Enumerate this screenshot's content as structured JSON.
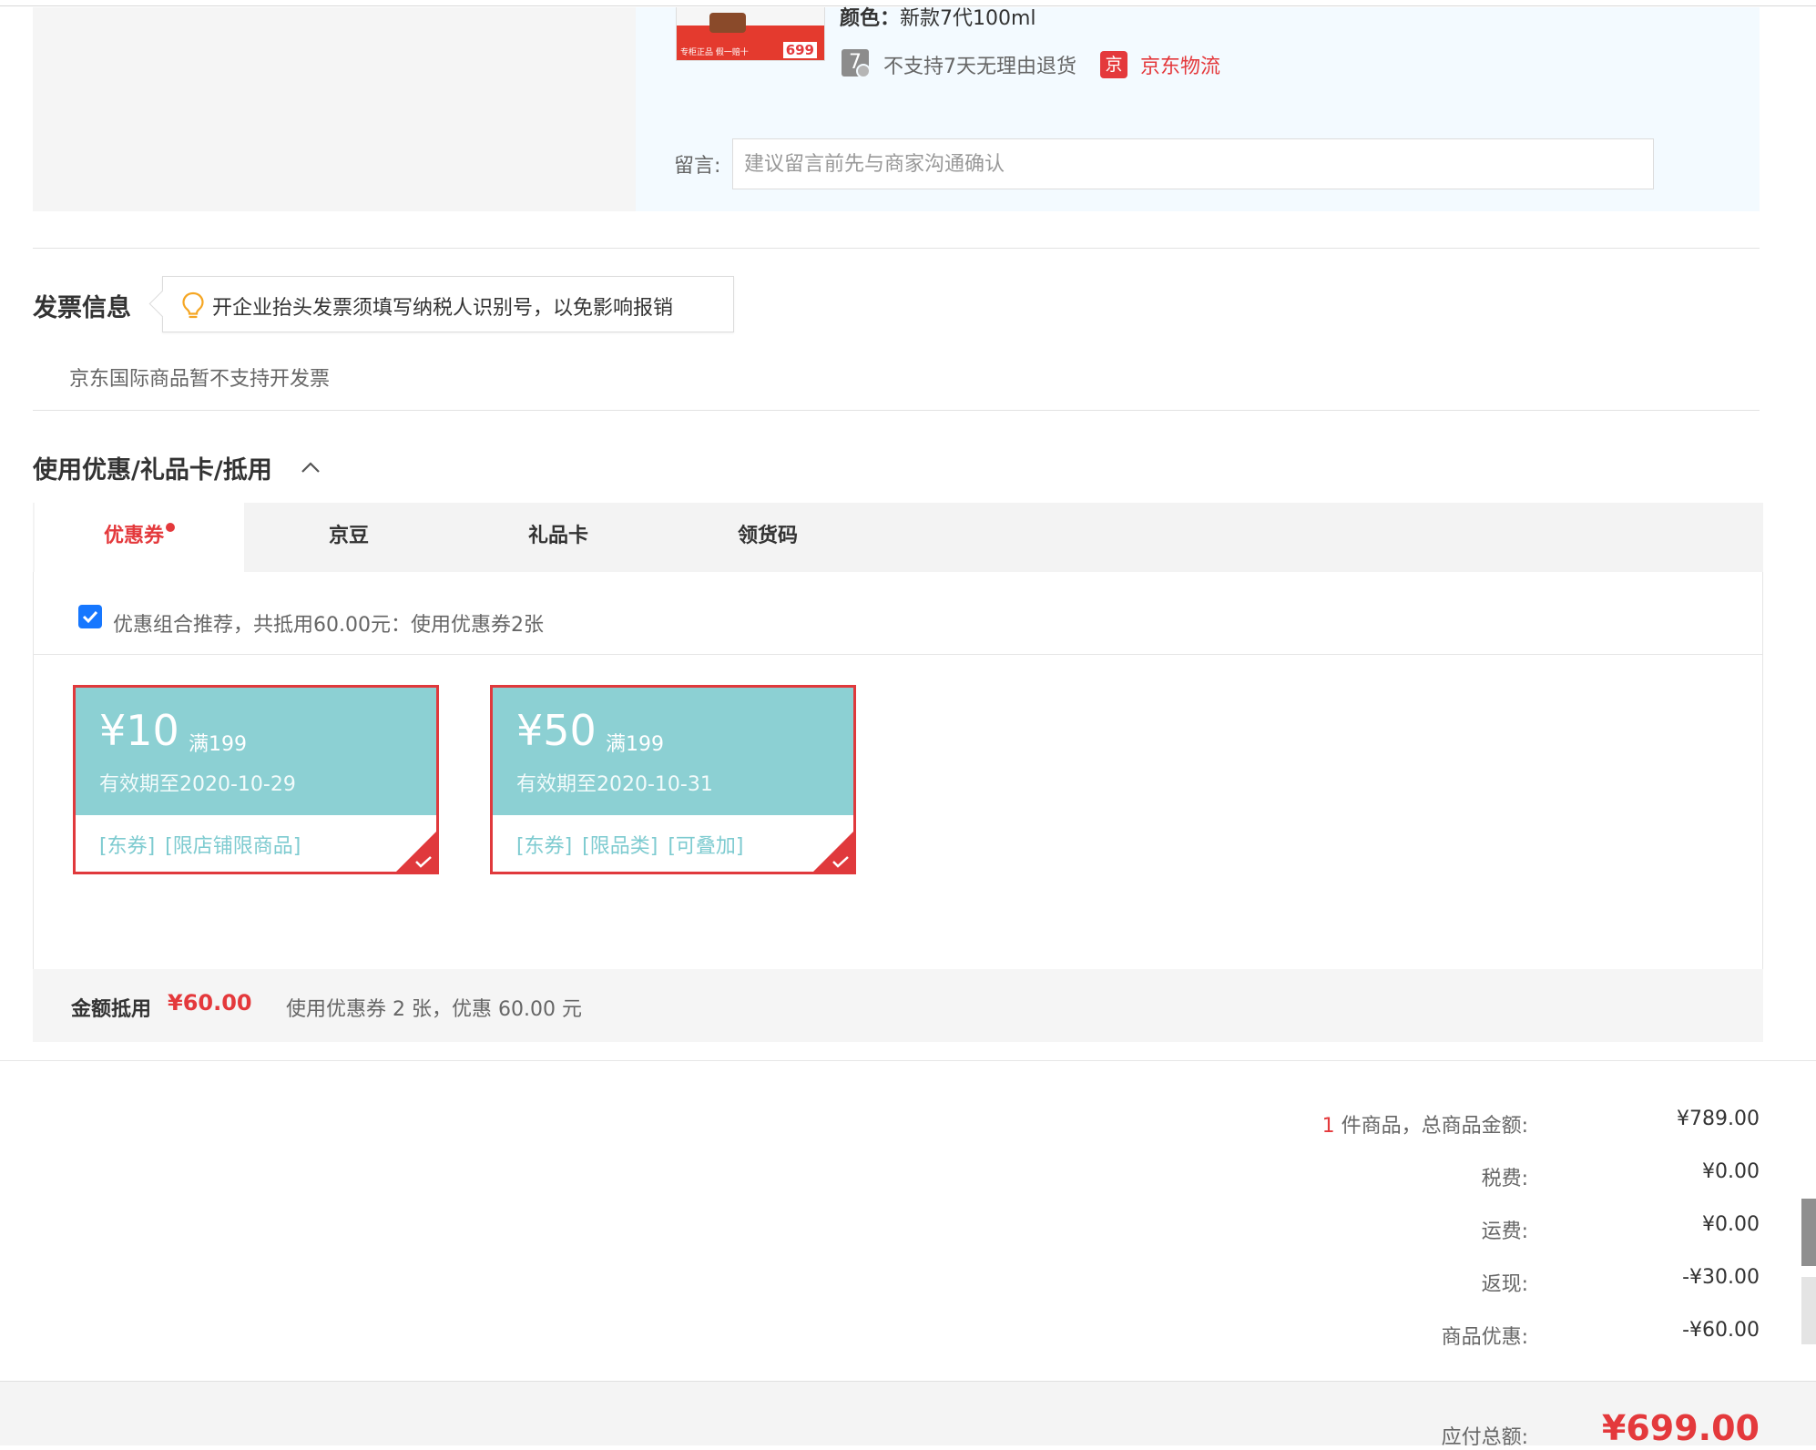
{
  "product": {
    "thumb_tag": "专柜正品 假一赔十",
    "thumb_price": "699",
    "color_label": "颜色：",
    "color_value": "新款7代100ml",
    "seven_icon": "7",
    "no_return": "不支持7天无理由退货",
    "jd_icon": "京",
    "logistics": "京东物流"
  },
  "message": {
    "label": "留言:",
    "placeholder": "建议留言前先与商家沟通确认"
  },
  "invoice": {
    "title": "发票信息",
    "tip": "开企业抬头发票须填写纳税人识别号，以免影响报销",
    "note": "京东国际商品暂不支持开发票"
  },
  "discount": {
    "title": "使用优惠/礼品卡/抵用",
    "tabs": [
      "优惠券",
      "京豆",
      "礼品卡",
      "领货码"
    ],
    "recommend": "优惠组合推荐，共抵用60.00元：使用优惠券2张",
    "coupons": [
      {
        "amount": "¥10",
        "min": "满199",
        "expiry": "有效期至2020-10-29",
        "tags": "[东券] [限店铺限商品]"
      },
      {
        "amount": "¥50",
        "min": "满199",
        "expiry": "有效期至2020-10-31",
        "tags": "[东券] [限品类] [可叠加]"
      }
    ],
    "summary_label": "金额抵用",
    "summary_amount": "¥60.00",
    "summary_desc": "使用优惠券 2 张，优惠 60.00 元"
  },
  "totals": {
    "count": "1",
    "goods_label": " 件商品，总商品金额:",
    "goods_value": "¥789.00",
    "tax_label": "税费:",
    "tax_value": "¥0.00",
    "shipping_label": "运费:",
    "shipping_value": "¥0.00",
    "cashback_label": "返现:",
    "cashback_value": "-¥30.00",
    "promo_label": "商品优惠:",
    "promo_value": "-¥60.00",
    "payable_label": "应付总额:",
    "payable_value": "¥699.00"
  },
  "colors": {
    "accent": "#e4393c",
    "coupon_bg": "#8cd0d3",
    "checkbox": "#1677ff"
  }
}
